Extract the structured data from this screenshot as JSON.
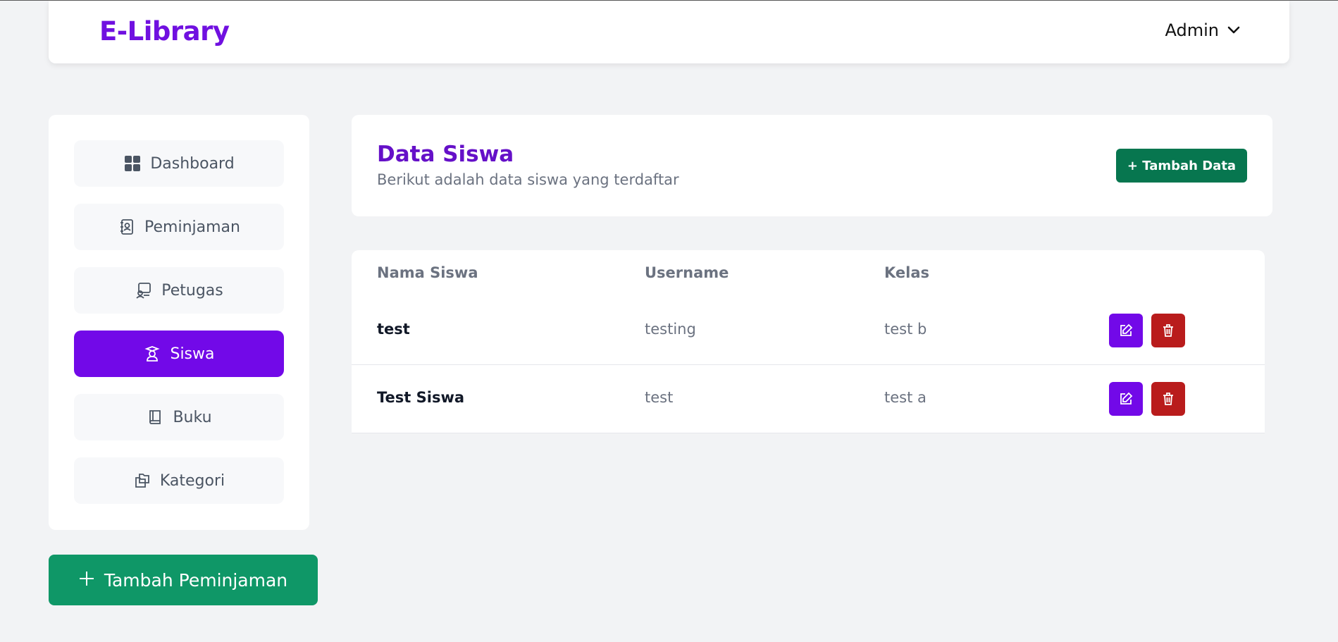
{
  "header": {
    "brand": "E-Library",
    "user": "Admin"
  },
  "sidebar": {
    "items": [
      {
        "label": "Dashboard",
        "icon": "grid-icon",
        "active": false
      },
      {
        "label": "Peminjaman",
        "icon": "contact-book-icon",
        "active": false
      },
      {
        "label": "Petugas",
        "icon": "staff-icon",
        "active": false
      },
      {
        "label": "Siswa",
        "icon": "student-icon",
        "active": true
      },
      {
        "label": "Buku",
        "icon": "book-icon",
        "active": false
      },
      {
        "label": "Kategori",
        "icon": "folders-icon",
        "active": false
      }
    ],
    "add_button": "Tambah Peminjaman"
  },
  "page": {
    "title": "Data Siswa",
    "subtitle": "Berikut adalah data siswa yang terdaftar",
    "add_button": "+ Tambah Data"
  },
  "table": {
    "columns": [
      "Nama Siswa",
      "Username",
      "Kelas"
    ],
    "rows": [
      {
        "nama": "test",
        "username": "testing",
        "kelas": "test b"
      },
      {
        "nama": "Test Siswa",
        "username": "test",
        "kelas": "test a"
      }
    ]
  },
  "colors": {
    "brand": "#7010e0",
    "active_nav": "#7209e8",
    "add_loan": "#0f9767",
    "add_data": "#07764f",
    "edit": "#7209e8",
    "delete": "#b91c1c"
  }
}
